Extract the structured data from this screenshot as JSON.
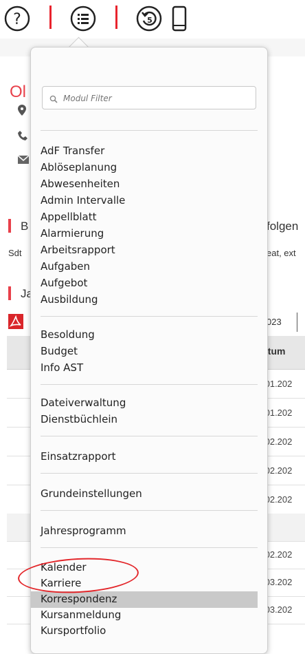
{
  "toolbar": {
    "icons": [
      "help-icon",
      "menu-list-icon",
      "history-icon",
      "mobile-icon"
    ]
  },
  "background": {
    "title_fragment": "Ol",
    "section1_fragment": "B",
    "follow_fragment": "folgen",
    "sdt_fragment": "Sdt",
    "extra_fragment": "eat, ext",
    "section2_fragment": "Ja",
    "year_fragment": "023",
    "column_fragment": "atum",
    "dates": [
      ".01.202",
      ".01.202",
      ".02.202",
      ".02.202",
      ".02.202",
      "",
      ".02.202",
      ".03.202",
      ".03.202"
    ]
  },
  "menu": {
    "filter_placeholder": "Modul Filter",
    "groups": [
      {
        "items": [
          "AdF Transfer",
          "Ablöseplanung",
          "Abwesenheiten",
          "Admin Intervalle",
          "Appellblatt",
          "Alarmierung",
          "Arbeitsrapport",
          "Aufgaben",
          "Aufgebot",
          "Ausbildung"
        ]
      },
      {
        "items": [
          "Besoldung",
          "Budget",
          "Info AST"
        ]
      },
      {
        "items": [
          "Dateiverwaltung",
          "Dienstbüchlein"
        ]
      },
      {
        "items": [
          "Einsatzrapport"
        ]
      },
      {
        "items": [
          "Grundeinstellungen"
        ]
      },
      {
        "items": [
          "Jahresprogramm"
        ]
      },
      {
        "items": [
          "Kalender",
          "Karriere",
          "Korrespondenz",
          "Kursanmeldung",
          "Kursportfolio"
        ]
      }
    ],
    "selected_item": "Korrespondenz",
    "highlight_color": "#e3262a"
  }
}
